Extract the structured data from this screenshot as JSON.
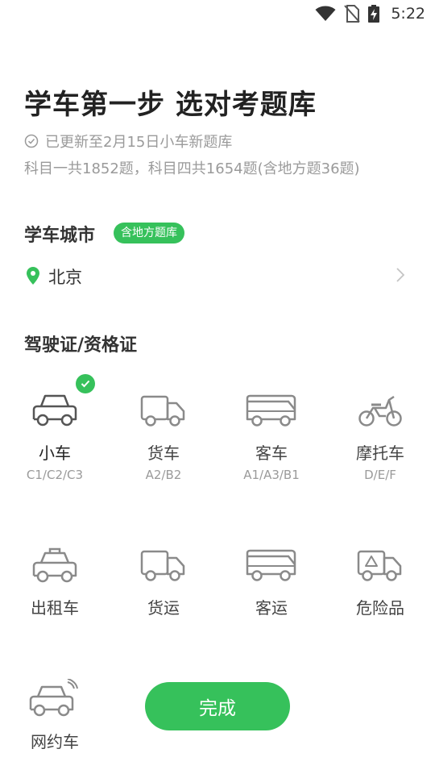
{
  "status_bar": {
    "time": "5:22",
    "icons": [
      "wifi-icon",
      "no-sim-icon",
      "battery-charging-icon"
    ]
  },
  "header": {
    "title": "学车第一步 选对考题库",
    "update_text": "已更新至2月15日小车新题库",
    "count_text": "科目一共1852题，科目四共1654题(含地方题36题)"
  },
  "city": {
    "section_title": "学车城市",
    "badge": "含地方题库",
    "selected": "北京"
  },
  "license": {
    "section_title": "驾驶证/资格证",
    "items": [
      {
        "name": "小车",
        "codes": "C1/C2/C3",
        "icon": "car-icon",
        "selected": true
      },
      {
        "name": "货车",
        "codes": "A2/B2",
        "icon": "truck-icon",
        "selected": false
      },
      {
        "name": "客车",
        "codes": "A1/A3/B1",
        "icon": "bus-icon",
        "selected": false
      },
      {
        "name": "摩托车",
        "codes": "D/E/F",
        "icon": "motorcycle-icon",
        "selected": false
      },
      {
        "name": "出租车",
        "codes": "",
        "icon": "taxi-icon",
        "selected": false
      },
      {
        "name": "货运",
        "codes": "",
        "icon": "freight-truck-icon",
        "selected": false
      },
      {
        "name": "客运",
        "codes": "",
        "icon": "passenger-bus-icon",
        "selected": false
      },
      {
        "name": "危险品",
        "codes": "",
        "icon": "hazmat-truck-icon",
        "selected": false
      },
      {
        "name": "网约车",
        "codes": "",
        "icon": "ride-hailing-car-icon",
        "selected": false
      }
    ]
  },
  "actions": {
    "done_label": "完成"
  },
  "colors": {
    "accent": "#36c15b",
    "icon_gray": "#8a8a8a",
    "text_gray": "#9a9a9a"
  }
}
